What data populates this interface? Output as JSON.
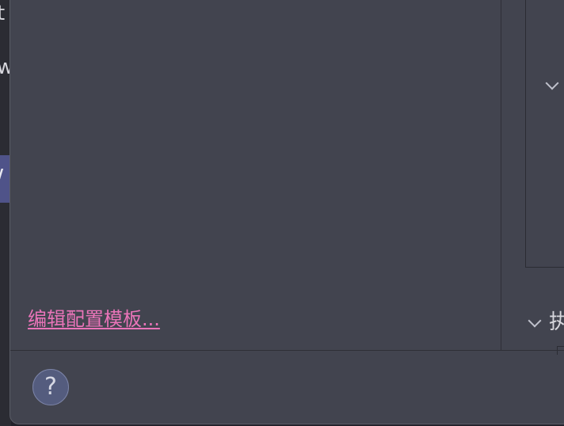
{
  "background_window": {
    "text_1": "t",
    "text_2": "w",
    "selected_text": "/"
  },
  "dialog": {
    "edit_templates_link": "编辑配置模板...",
    "right_panel": {
      "section_label": "执",
      "chevron_icon_1": "chevron-down-icon",
      "chevron_icon_2": "chevron-down-icon"
    },
    "footer": {
      "help_label": "?",
      "help_icon": "help-icon"
    }
  },
  "colors": {
    "dialog_bg": "#42444f",
    "link": "#ea74b9",
    "help_button_bg": "#545c7e",
    "selection_bg": "#4f5389"
  }
}
